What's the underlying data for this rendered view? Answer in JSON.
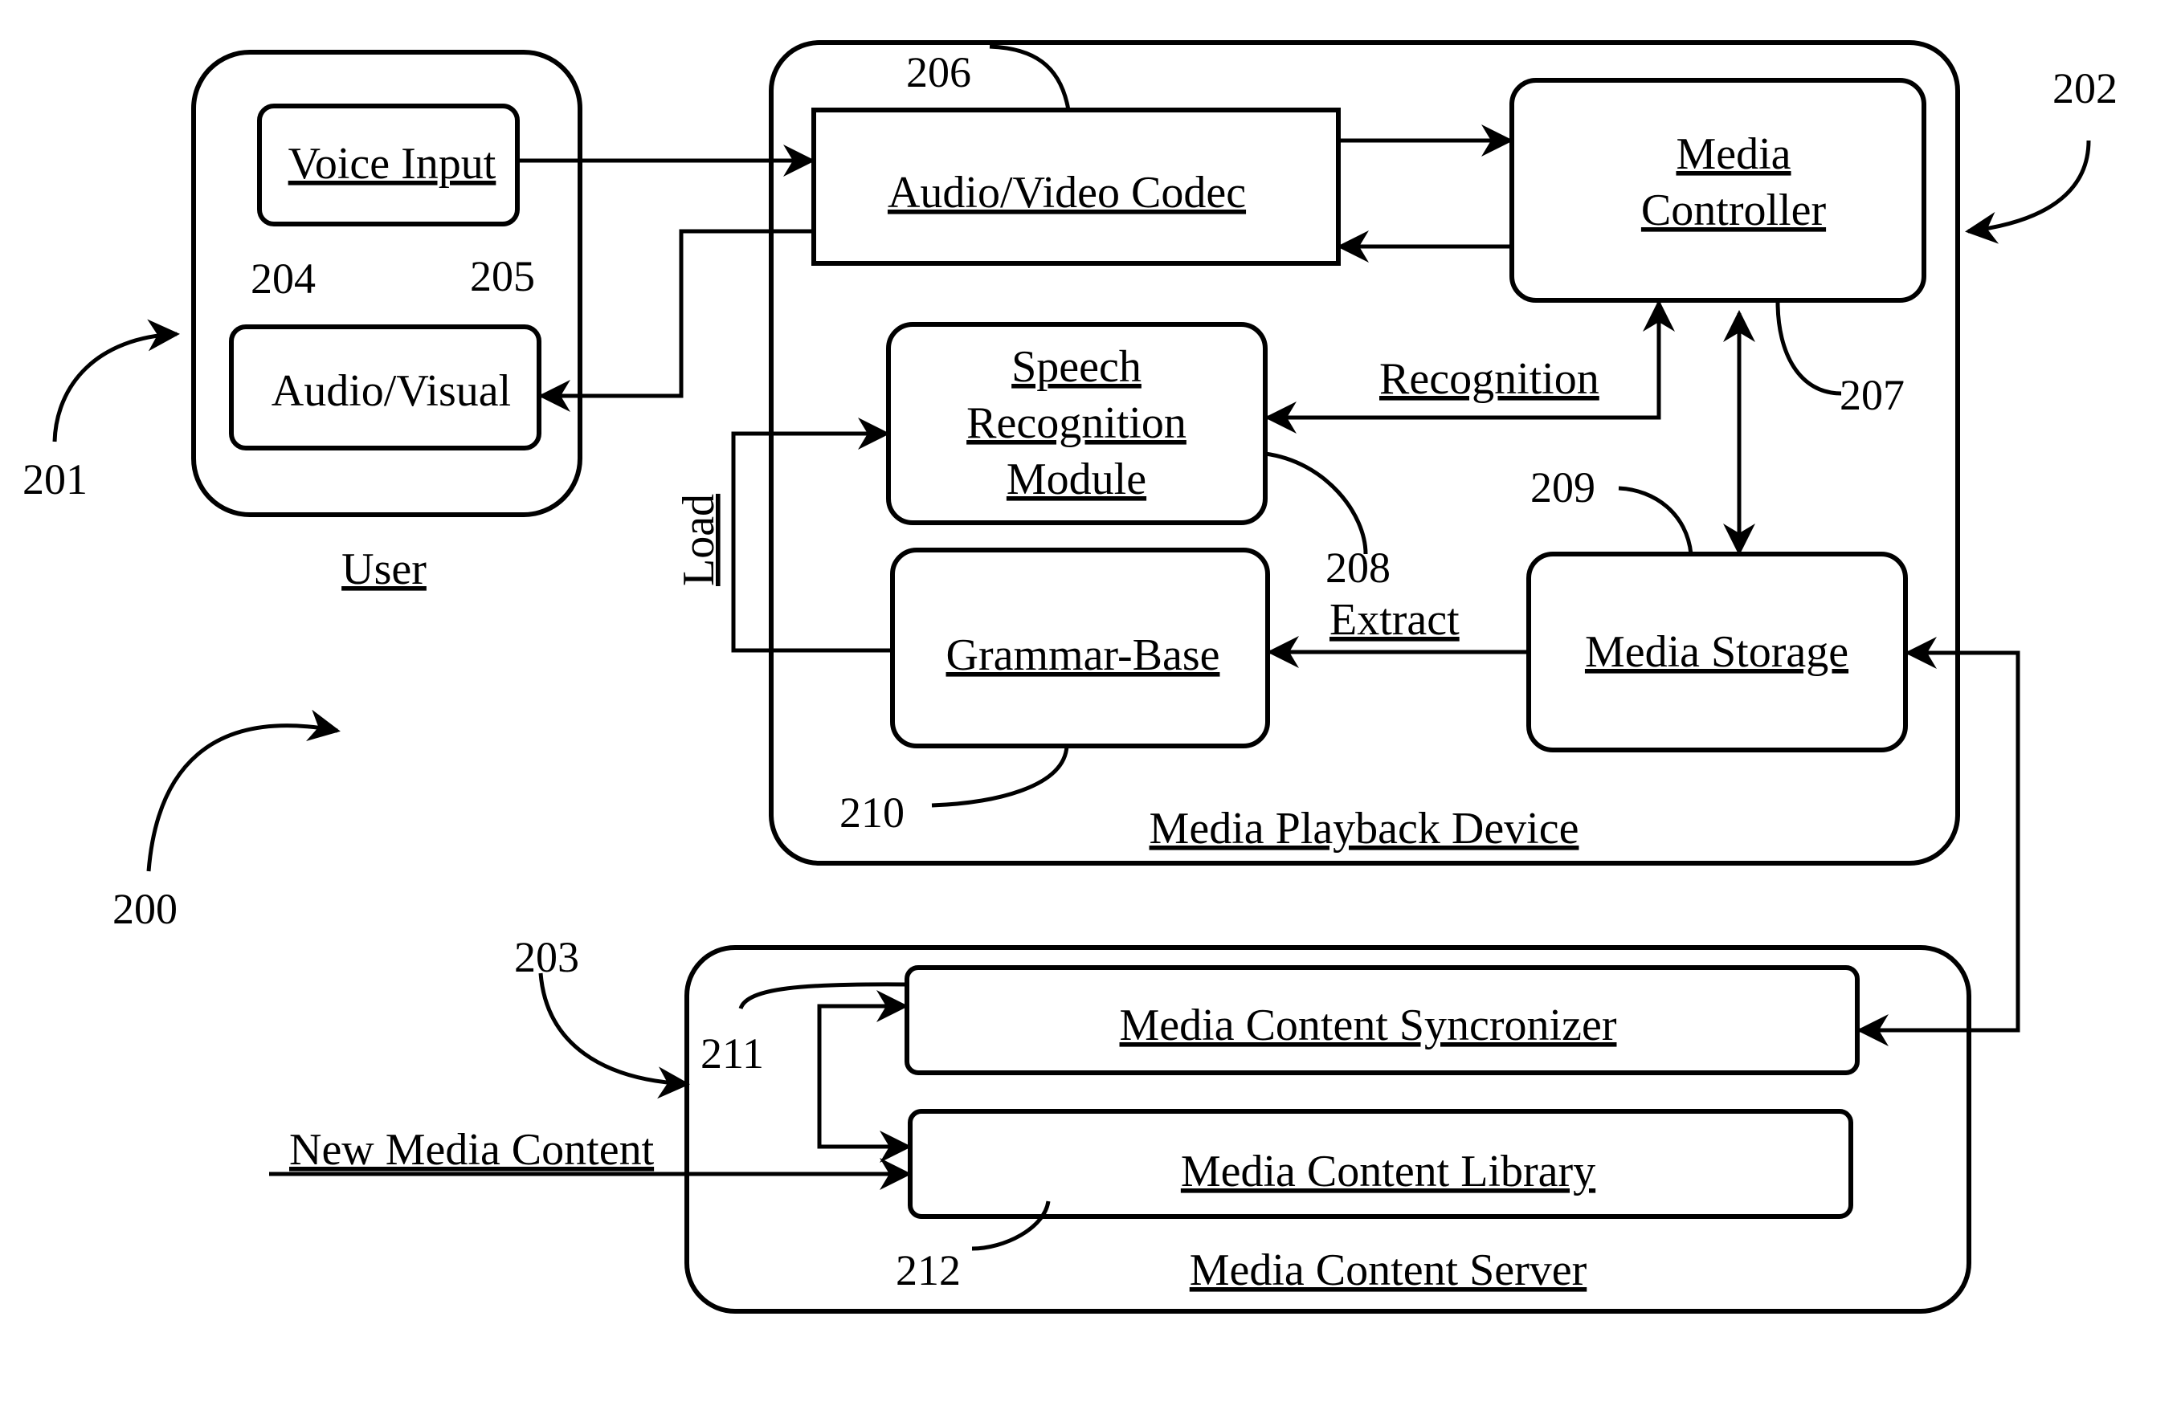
{
  "figure": {
    "ref": "200",
    "blocks": {
      "user": {
        "ref": "201",
        "label": "User"
      },
      "voice_input": {
        "ref": "204",
        "label": "Voice Input"
      },
      "audio_visual": {
        "ref": "205",
        "label": "Audio/Visual"
      },
      "media_playback_device": {
        "ref": "202",
        "label": "Media Playback Device"
      },
      "codec": {
        "ref": "206",
        "label": "Audio/Video Codec"
      },
      "media_controller": {
        "ref": "207",
        "label_line1": "Media",
        "label_line2": "Controller"
      },
      "speech_recognition": {
        "ref": "208",
        "label_line1": "Speech",
        "label_line2": "Recognition",
        "label_line3": "Module"
      },
      "media_storage": {
        "ref": "209",
        "label": "Media Storage"
      },
      "grammar_base": {
        "ref": "210",
        "label": "Grammar-Base"
      },
      "media_content_server": {
        "ref": "203",
        "label": "Media Content Server"
      },
      "synchronizer": {
        "ref": "211",
        "label": "Media Content Syncronizer"
      },
      "library": {
        "ref": "212",
        "label": "Media Content Library"
      }
    },
    "edge_labels": {
      "load": "Load",
      "recognition": "Recognition",
      "extract": "Extract",
      "new_media_content": "New Media Content"
    }
  }
}
